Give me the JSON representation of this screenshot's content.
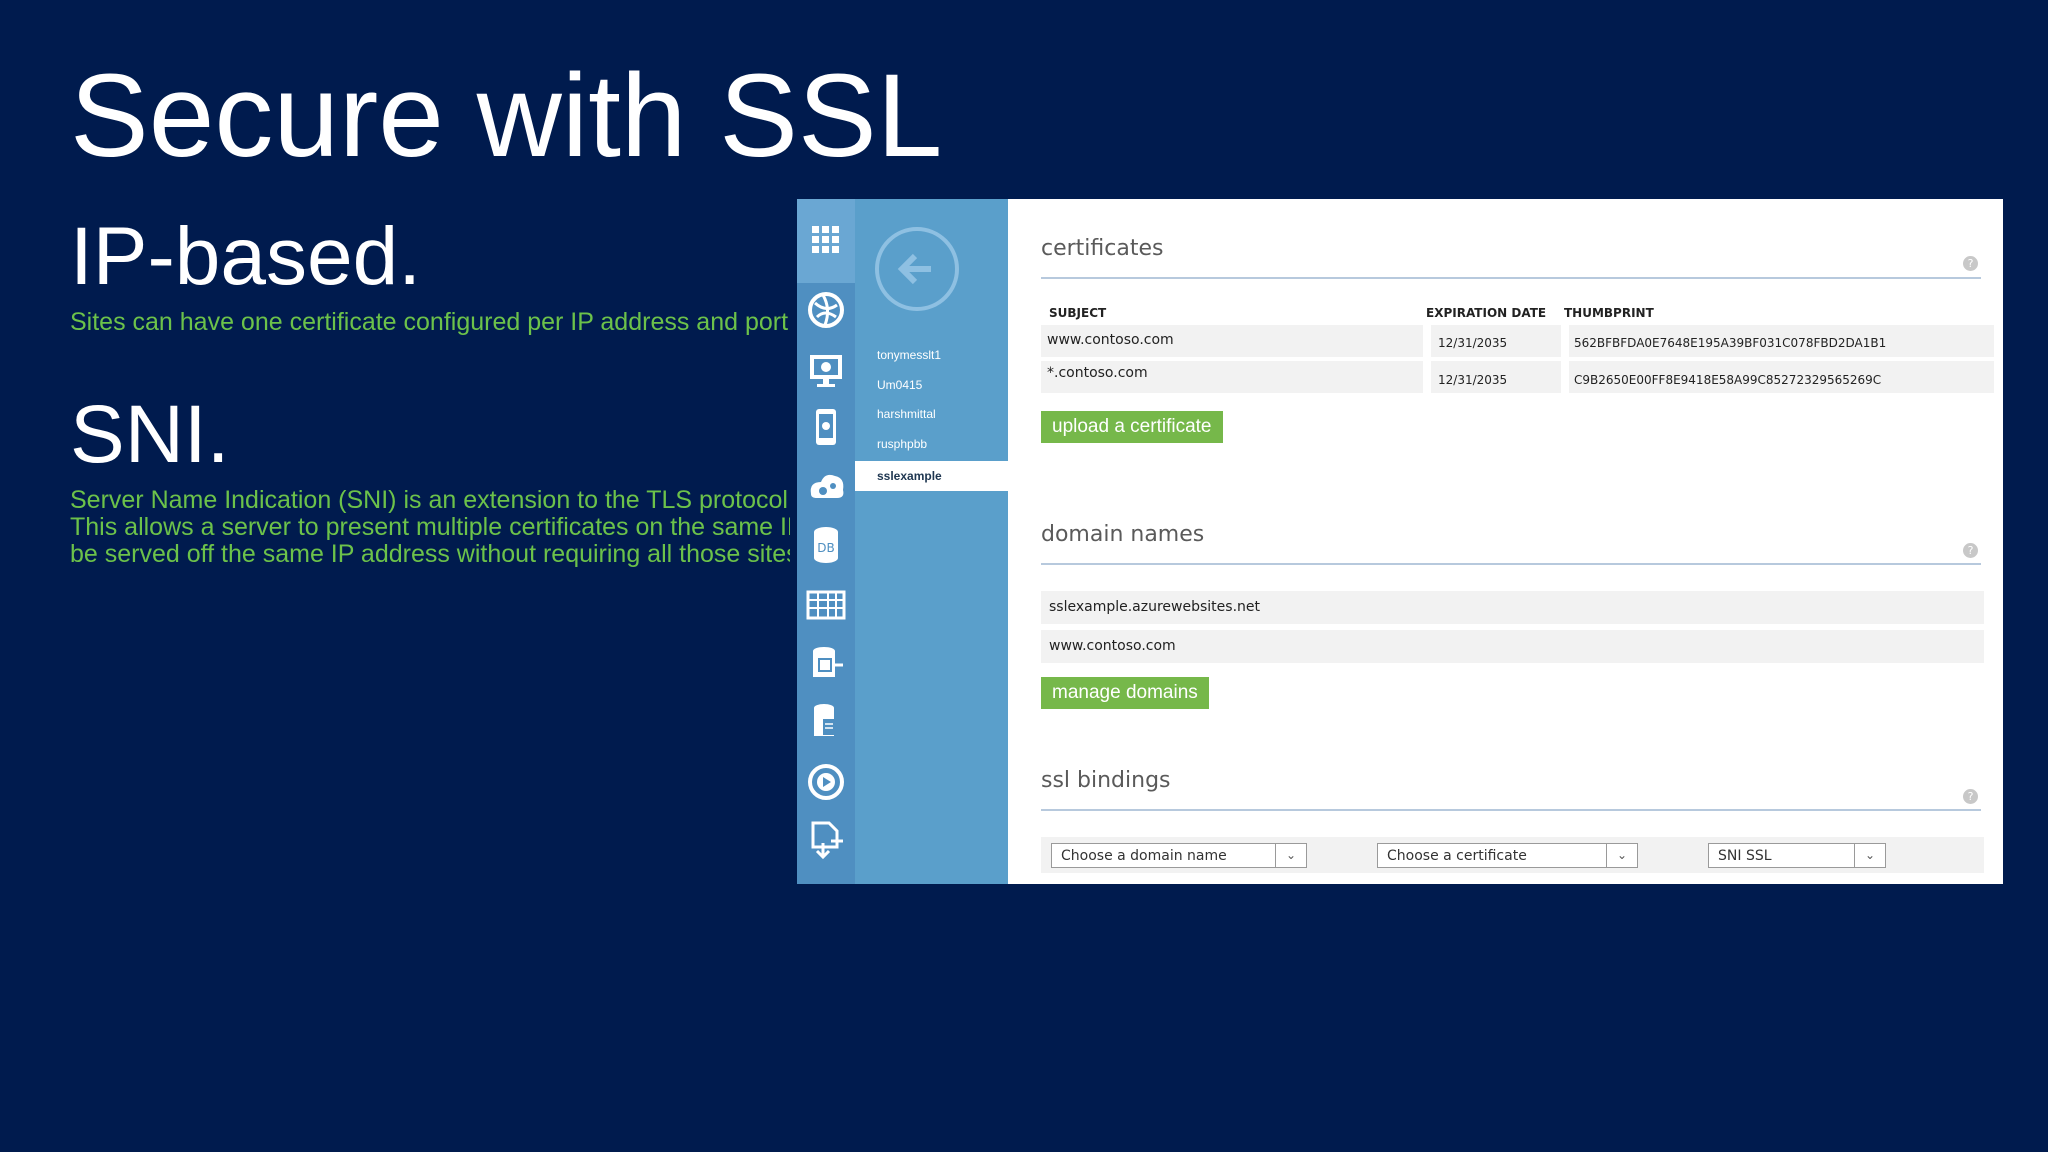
{
  "slide": {
    "title": "Secure with SSL",
    "ip_heading": "IP-based.",
    "ip_text": "Sites can have one certificate configured per IP address and port number.",
    "sni_heading": "SNI.",
    "sni_lines": [
      "Server Name Indication (SNI) is an extension to the TLS protocol that",
      "This allows a server to present multiple certificates on the same IP",
      "be served off the same IP address without requiring all those sites"
    ]
  },
  "portal": {
    "rail_icons": [
      "grid-icon",
      "globe-icon",
      "monitor-icon",
      "mobile-icon",
      "gears-icon",
      "database-icon",
      "table-icon",
      "storage-icon",
      "document-store-icon",
      "media-icon",
      "import-icon"
    ],
    "rail_db_label": "DB",
    "nav": {
      "items": [
        "tonymesslt1",
        "Um0415",
        "harshmittal",
        "rusphpbb",
        "sslexample"
      ],
      "selected": "sslexample"
    },
    "certificates": {
      "title": "certificates",
      "columns": [
        "SUBJECT",
        "EXPIRATION DATE",
        "THUMBPRINT"
      ],
      "rows": [
        {
          "subject": "www.contoso.com",
          "expiration": "12/31/2035",
          "thumbprint": "562BFBFDA0E7648E195A39BF031C078FBD2DA1B1"
        },
        {
          "subject": "*.contoso.com",
          "expiration": "12/31/2035",
          "thumbprint": "C9B2650E00FF8E9418E58A99C85272329565269C"
        }
      ],
      "upload_label": "upload a certificate"
    },
    "domains": {
      "title": "domain names",
      "items": [
        "sslexample.azurewebsites.net",
        "www.contoso.com"
      ],
      "manage_label": "manage domains"
    },
    "bindings": {
      "title": "ssl bindings",
      "domain_select": "Choose a domain name",
      "cert_select": "Choose a certificate",
      "type_select": "SNI SSL"
    },
    "help_glyph": "?"
  },
  "colors": {
    "background": "#001b4e",
    "accent_green": "#6cc24a",
    "button_green": "#76b84a",
    "rail_blue": "#4f8fc1",
    "nav_blue": "#5a9fcb"
  }
}
